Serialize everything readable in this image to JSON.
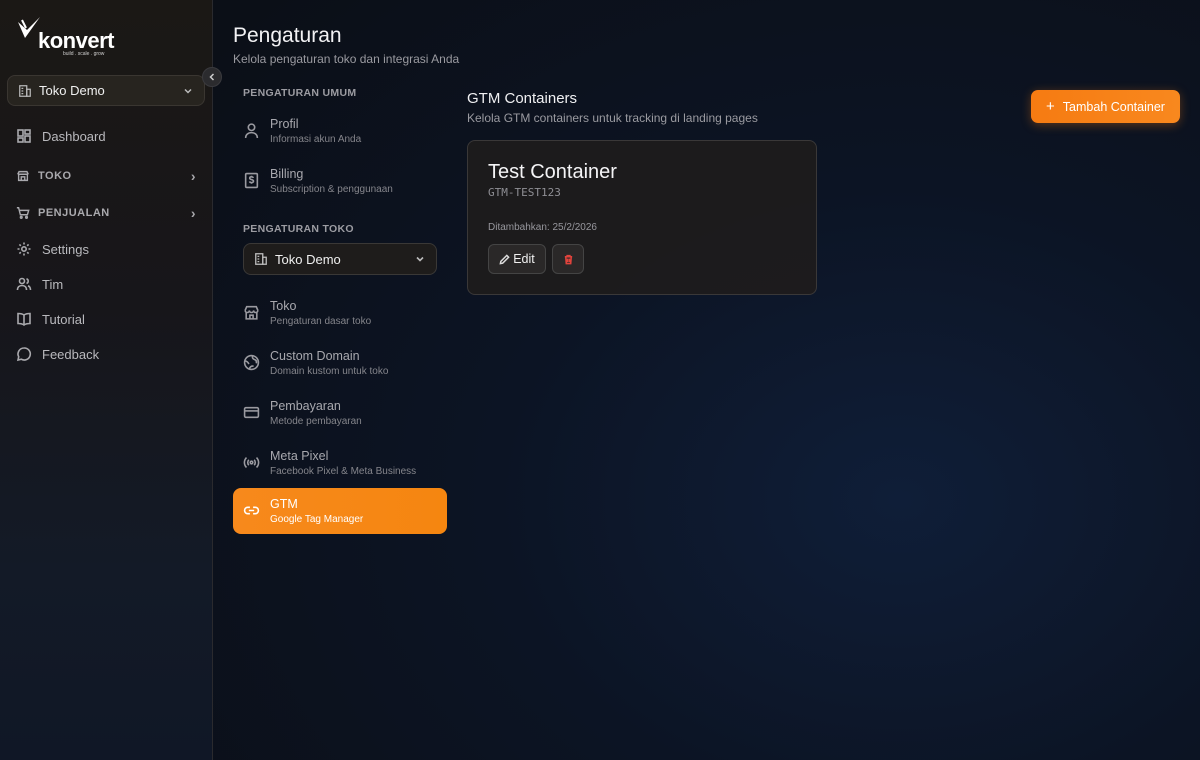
{
  "brand": {
    "name": "konvert",
    "tagline": "build . scale . grow"
  },
  "sidebar": {
    "store_select": "Toko Demo",
    "items": [
      {
        "label": "Dashboard",
        "icon": "dashboard-icon"
      },
      {
        "label": "TOKO",
        "icon": "store-icon",
        "type": "section"
      },
      {
        "label": "PENJUALAN",
        "icon": "cart-icon",
        "type": "section"
      },
      {
        "label": "Settings",
        "icon": "gear-icon"
      },
      {
        "label": "Tim",
        "icon": "users-icon"
      },
      {
        "label": "Tutorial",
        "icon": "book-icon"
      },
      {
        "label": "Feedback",
        "icon": "chat-icon"
      }
    ]
  },
  "header": {
    "title": "Pengaturan",
    "subtitle": "Kelola pengaturan toko dan integrasi Anda"
  },
  "settings_menu": {
    "general_heading": "PENGATURAN UMUM",
    "general_items": [
      {
        "title": "Profil",
        "subtitle": "Informasi akun Anda",
        "icon": "user-icon"
      },
      {
        "title": "Billing",
        "subtitle": "Subscription & penggunaan",
        "icon": "billing-icon"
      }
    ],
    "store_heading": "PENGATURAN TOKO",
    "store_select": "Toko Demo",
    "store_items": [
      {
        "title": "Toko",
        "subtitle": "Pengaturan dasar toko",
        "icon": "store-icon"
      },
      {
        "title": "Custom Domain",
        "subtitle": "Domain kustom untuk toko",
        "icon": "globe-icon"
      },
      {
        "title": "Pembayaran",
        "subtitle": "Metode pembayaran",
        "icon": "credit-card-icon"
      },
      {
        "title": "Meta Pixel",
        "subtitle": "Facebook Pixel & Meta Business",
        "icon": "broadcast-icon"
      },
      {
        "title": "GTM",
        "subtitle": "Google Tag Manager",
        "icon": "link-icon",
        "active": true
      }
    ]
  },
  "main": {
    "title": "GTM Containers",
    "subtitle": "Kelola GTM containers untuk tracking di landing pages",
    "add_button": "Tambah Container",
    "containers": [
      {
        "name": "Test Container",
        "id": "GTM-TEST123",
        "added": "Ditambahkan: 25/2/2026",
        "edit_label": "Edit"
      }
    ]
  },
  "colors": {
    "accent": "#f7891c",
    "danger": "#e0433c"
  }
}
